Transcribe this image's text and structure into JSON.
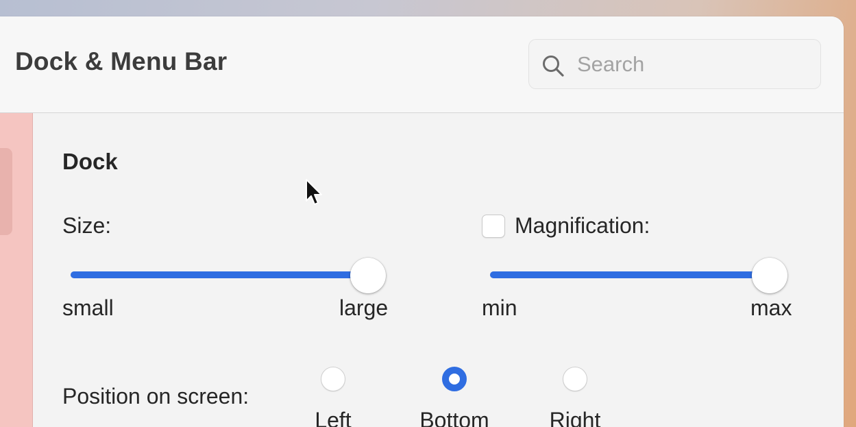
{
  "window": {
    "title": "Dock & Menu Bar"
  },
  "search": {
    "placeholder": "Search",
    "icon": "search-icon"
  },
  "dock": {
    "section_title": "Dock",
    "size": {
      "label": "Size:",
      "min_label": "small",
      "max_label": "large",
      "value_fraction": 1.0
    },
    "magnification": {
      "checkbox_label": "Magnification:",
      "checked": false,
      "min_label": "min",
      "max_label": "max",
      "value_fraction": 1.0
    },
    "position": {
      "label": "Position on screen:",
      "options": [
        "Left",
        "Bottom",
        "Right"
      ],
      "selected": "Bottom"
    }
  },
  "colors": {
    "accent": "#2f6de1",
    "sidebar": "#f5c5c1"
  }
}
